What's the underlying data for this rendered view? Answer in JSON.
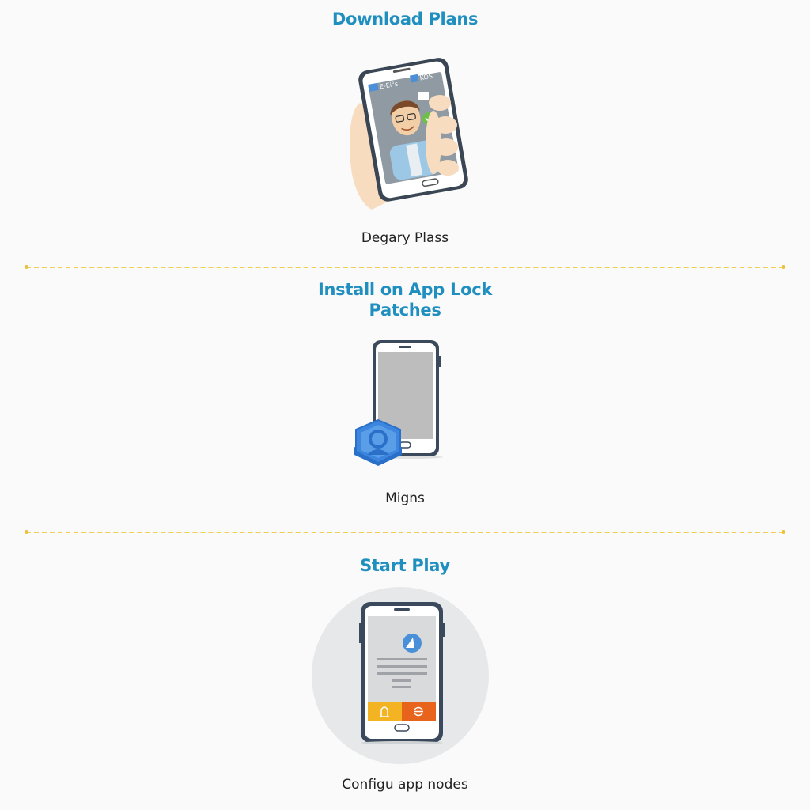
{
  "steps": [
    {
      "title": "Download Plans",
      "caption": "Degary Plass",
      "illustration": "hand-holding-phone-video-call"
    },
    {
      "title_line1": "Install on App Lock",
      "title_line2": "Patches",
      "caption": "Migns",
      "illustration": "phone-with-shield-lock"
    },
    {
      "title": "Start Play",
      "caption": "Configu app nodes",
      "illustration": "phone-app-screen-in-circle"
    }
  ],
  "phone1_status": {
    "left_text": "E-Ei°s",
    "right_text": "KOS"
  },
  "colors": {
    "heading": "#1f8fbf",
    "divider": "#f2cf52",
    "accent_yellow": "#f4b323",
    "accent_orange": "#e8631c",
    "shield_blue": "#3d86e0",
    "phone_frame": "#3a4a5c"
  }
}
